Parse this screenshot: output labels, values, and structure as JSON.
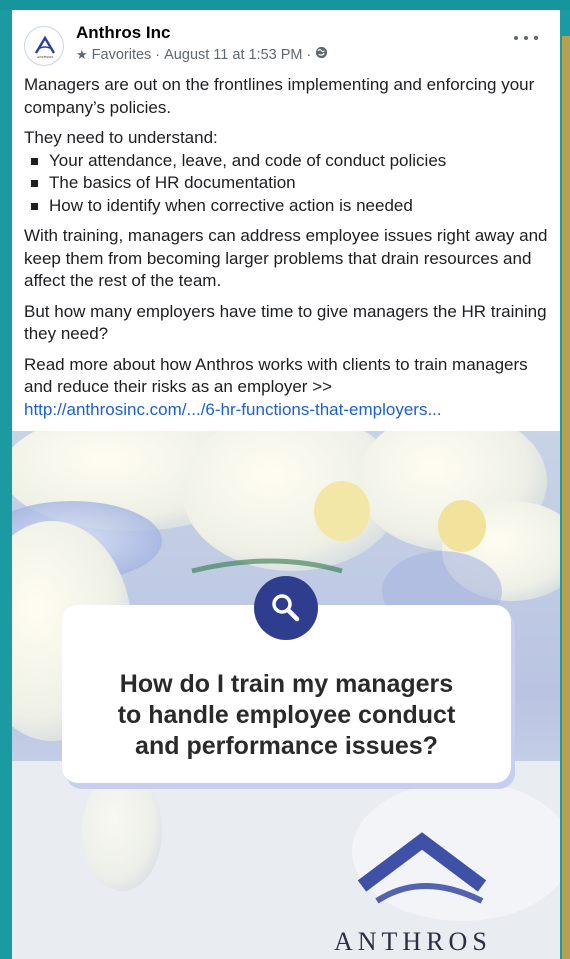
{
  "post": {
    "page_name": "Anthros Inc",
    "meta": {
      "favorites_label": "Favorites",
      "separator": "·",
      "timestamp": "August 11 at 1:53 PM",
      "audience_icon": "globe-icon"
    },
    "avatar": {
      "letter": "A",
      "sub_label": "ANTHROS"
    },
    "more_icon": "more-horizontal-icon",
    "text": {
      "p1": "Managers are out on the frontlines implementing and enforcing your company’s policies.",
      "p2": "They need to understand:",
      "bullets": [
        "Your attendance, leave, and code of conduct policies",
        "The basics of HR documentation",
        "How to identify when corrective action is needed"
      ],
      "p3": "With training, managers can address employee issues right away and keep them from becoming larger problems that drain resources and affect the rest of the team.",
      "p4": "But how many employers have time to give managers the HR training they need?",
      "p5": "Read more about how Anthros works with clients to train managers and reduce their risks as an employer >>",
      "link": "http://anthrosinc.com/.../6-hr-functions-that-employers..."
    },
    "image": {
      "headline": "How do I train my managers\nto handle employee conduct\nand performance issues?",
      "wordmark": "ANTHROS",
      "colors": {
        "badge": "#2f3d8e",
        "callout_shadow": "#c7cef1",
        "logo_blue": "#2a3f9c"
      }
    }
  },
  "colors": {
    "background": "#1b9aa1",
    "link": "#1b5fd0",
    "meta_text": "#606770"
  }
}
